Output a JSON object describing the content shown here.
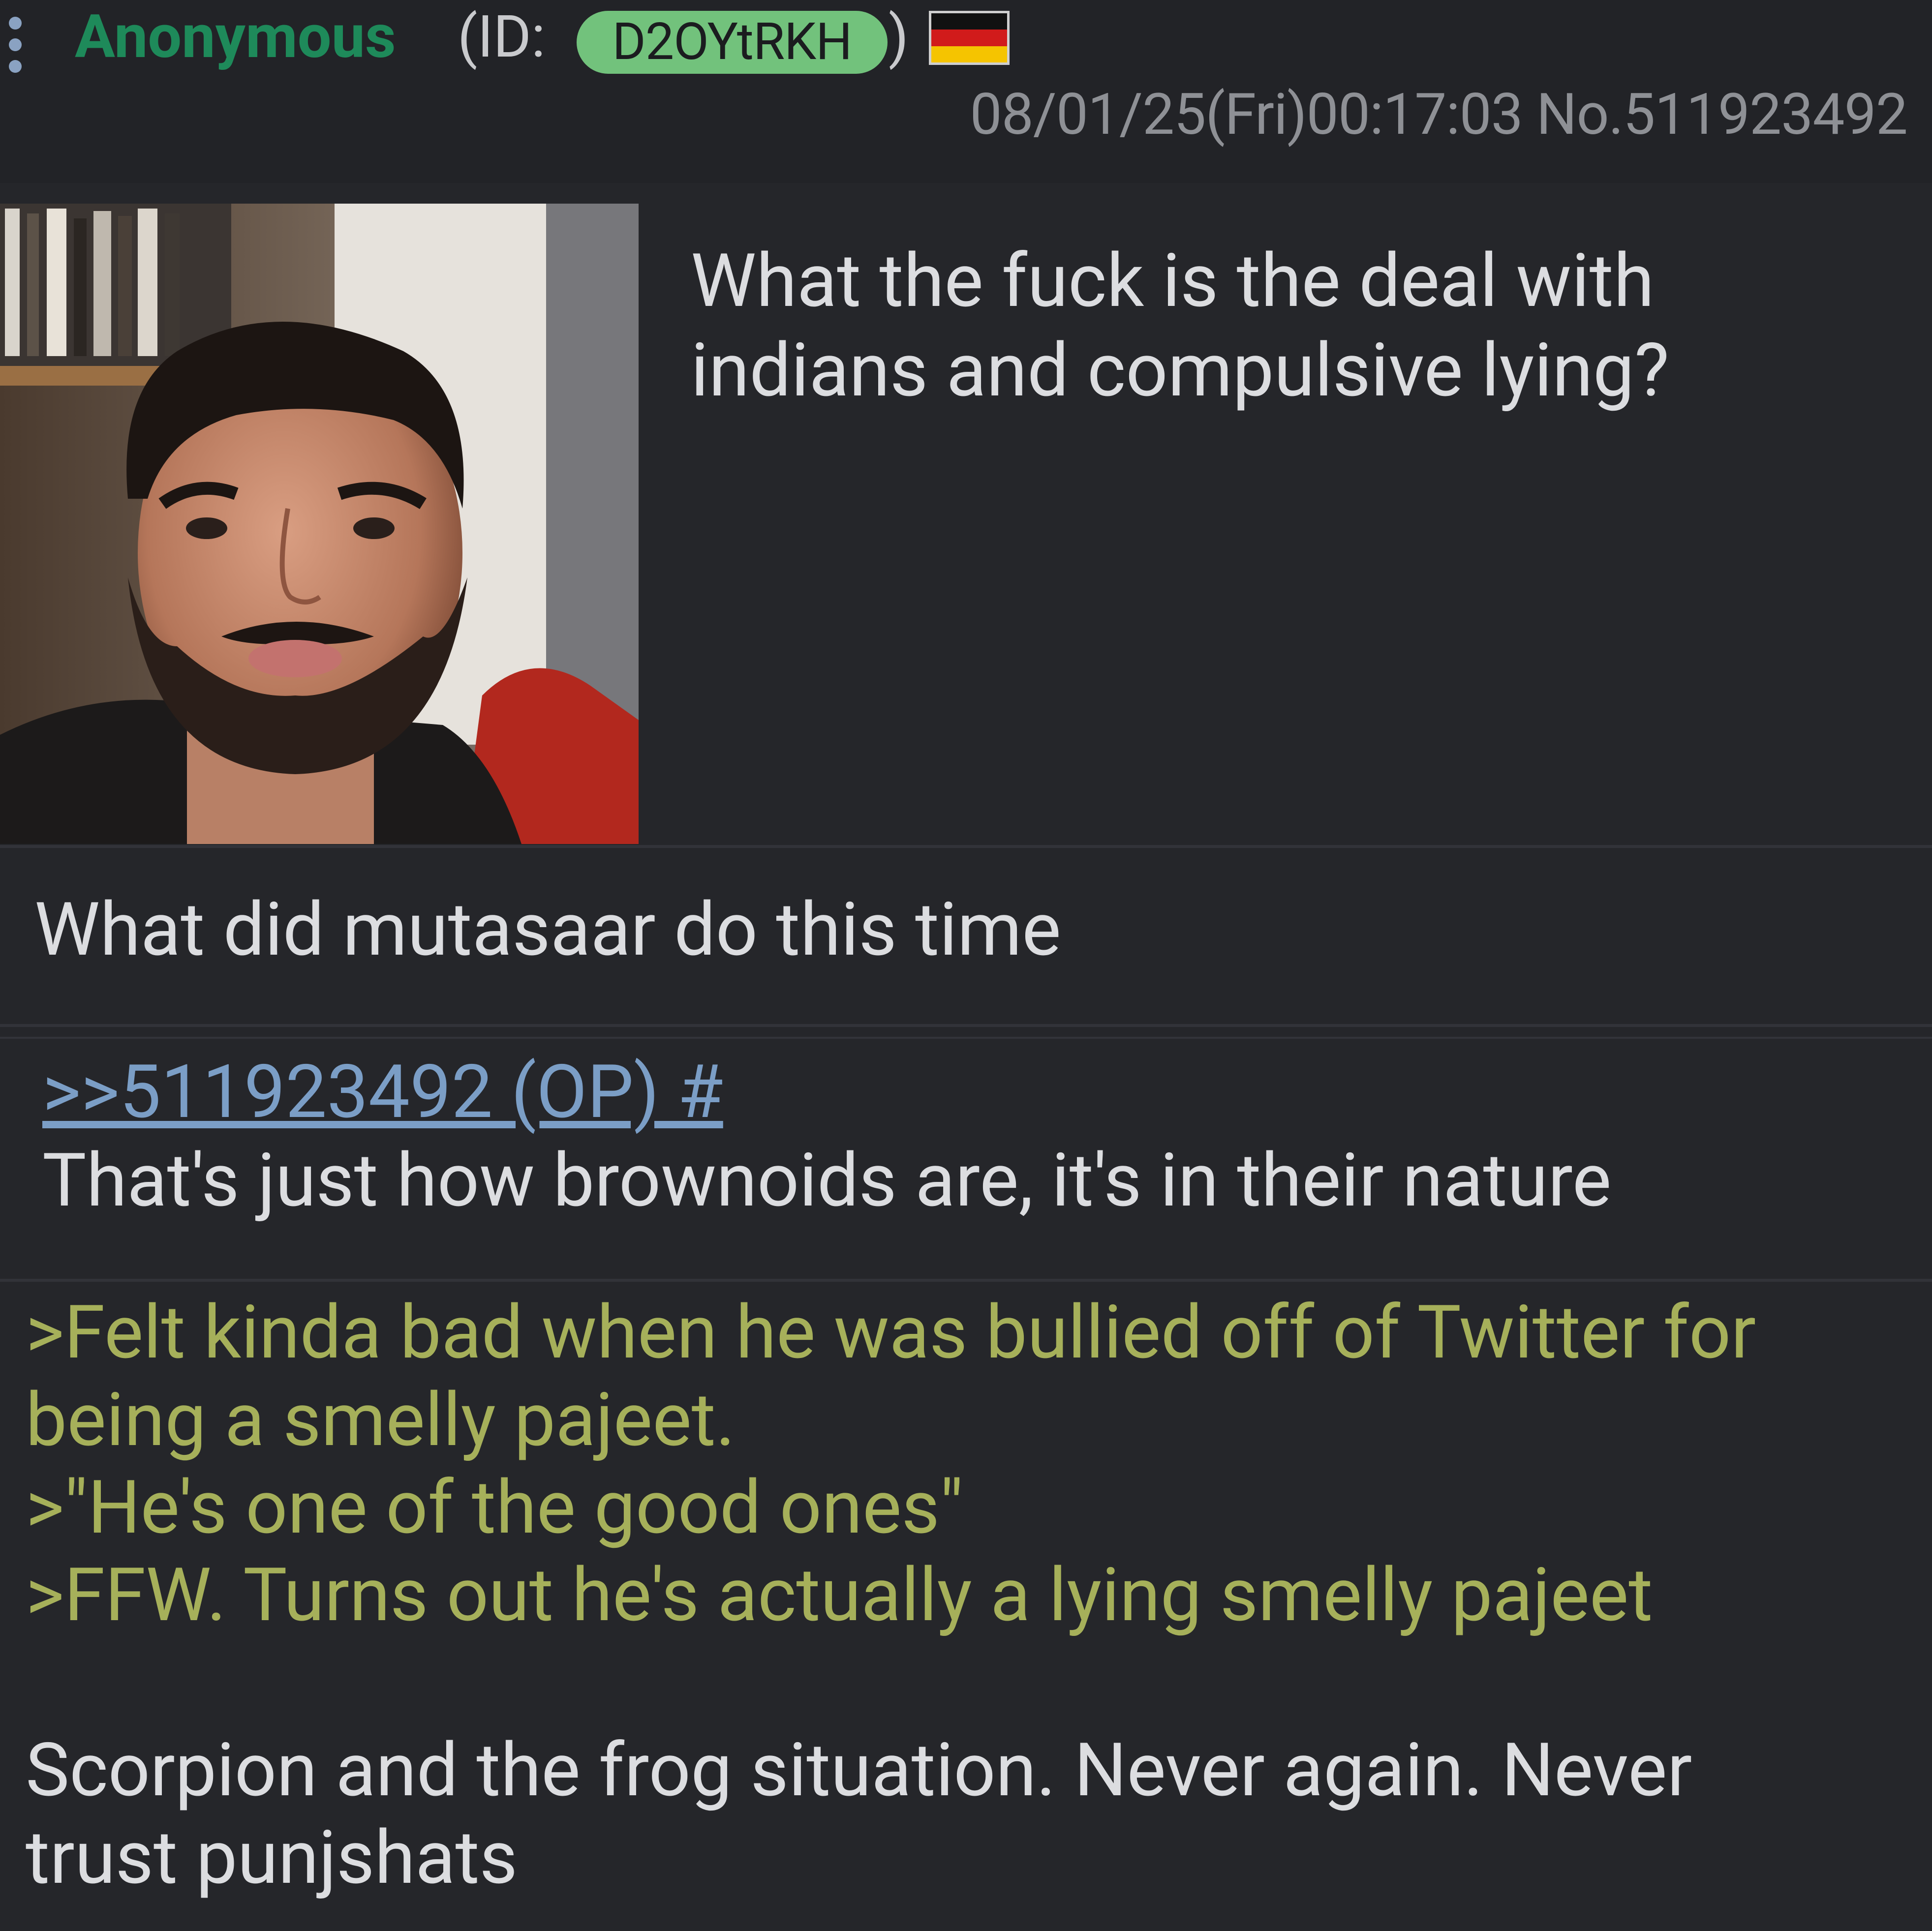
{
  "post": {
    "name": "Anonymous",
    "id_prefix": "(ID: ",
    "id": "D2OYtRKH",
    "id_suffix": ")",
    "flag": "Germany",
    "timestamp": "08/01/25(Fri)00:17:03",
    "number": "No.511923492",
    "text_line1": "What the fuck is the deal with",
    "text_line2": "indians and compulsive lying?"
  },
  "replies": [
    {
      "text": "What did mutasaar do this time"
    },
    {
      "quote": ">>511923492 (OP) #",
      "text": "That's just how brownoids are, it's in their nature"
    },
    {
      "greentext": [
        ">Felt kinda bad when he was bullied off of Twitter for",
        "being a smelly pajeet.",
        ">\"He's one of the good ones\"",
        ">FFW. Turns out he's actually a lying smelly pajeet"
      ],
      "text_line1": "Scorpion and the frog situation. Never again. Never",
      "text_line2": "trust punjshats"
    }
  ],
  "colors": {
    "name": "#1e8a5a",
    "id_badge": "#72c27c",
    "greentext": "#a6b05a",
    "quotelink": "#7b9ec6",
    "background": "#25262a"
  },
  "icons": [
    "more-vert-icon",
    "germany-flag-icon"
  ]
}
